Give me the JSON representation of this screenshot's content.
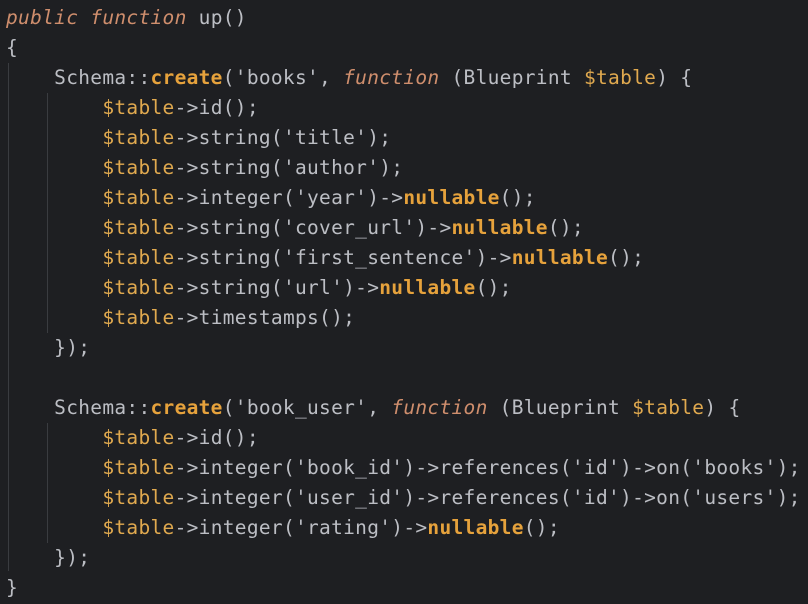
{
  "colors": {
    "background": "#1e1f22",
    "default_text": "#bcbec4",
    "keyword": "#cf8e6d",
    "function_call": "#e6a23c",
    "variable": "#e0a94f",
    "string": "#cfcfcf",
    "indent_guide": "#3a3c40"
  },
  "code": {
    "lines": [
      [
        {
          "t": "public",
          "c": "kw"
        },
        {
          "t": " ",
          "c": "tx"
        },
        {
          "t": "function",
          "c": "kw"
        },
        {
          "t": " up()",
          "c": "tx"
        }
      ],
      [
        {
          "t": "{",
          "c": "tx"
        }
      ],
      [
        {
          "t": "    Schema::",
          "c": "tx"
        },
        {
          "t": "create",
          "c": "fn"
        },
        {
          "t": "('books', ",
          "c": "tx"
        },
        {
          "t": "function",
          "c": "kw"
        },
        {
          "t": " (Blueprint ",
          "c": "tx"
        },
        {
          "t": "$table",
          "c": "var"
        },
        {
          "t": ") {",
          "c": "tx"
        }
      ],
      [
        {
          "t": "        ",
          "c": "tx"
        },
        {
          "t": "$table",
          "c": "var"
        },
        {
          "t": "->id();",
          "c": "tx"
        }
      ],
      [
        {
          "t": "        ",
          "c": "tx"
        },
        {
          "t": "$table",
          "c": "var"
        },
        {
          "t": "->string('title');",
          "c": "tx"
        }
      ],
      [
        {
          "t": "        ",
          "c": "tx"
        },
        {
          "t": "$table",
          "c": "var"
        },
        {
          "t": "->string('author');",
          "c": "tx"
        }
      ],
      [
        {
          "t": "        ",
          "c": "tx"
        },
        {
          "t": "$table",
          "c": "var"
        },
        {
          "t": "->integer('year')->",
          "c": "tx"
        },
        {
          "t": "nullable",
          "c": "fn"
        },
        {
          "t": "();",
          "c": "tx"
        }
      ],
      [
        {
          "t": "        ",
          "c": "tx"
        },
        {
          "t": "$table",
          "c": "var"
        },
        {
          "t": "->string('cover_url')->",
          "c": "tx"
        },
        {
          "t": "nullable",
          "c": "fn"
        },
        {
          "t": "();",
          "c": "tx"
        }
      ],
      [
        {
          "t": "        ",
          "c": "tx"
        },
        {
          "t": "$table",
          "c": "var"
        },
        {
          "t": "->string('first_sentence')->",
          "c": "tx"
        },
        {
          "t": "nullable",
          "c": "fn"
        },
        {
          "t": "();",
          "c": "tx"
        }
      ],
      [
        {
          "t": "        ",
          "c": "tx"
        },
        {
          "t": "$table",
          "c": "var"
        },
        {
          "t": "->string('url')->",
          "c": "tx"
        },
        {
          "t": "nullable",
          "c": "fn"
        },
        {
          "t": "();",
          "c": "tx"
        }
      ],
      [
        {
          "t": "        ",
          "c": "tx"
        },
        {
          "t": "$table",
          "c": "var"
        },
        {
          "t": "->timestamps();",
          "c": "tx"
        }
      ],
      [
        {
          "t": "    });",
          "c": "tx"
        }
      ],
      [
        {
          "t": "",
          "c": "tx"
        }
      ],
      [
        {
          "t": "    Schema::",
          "c": "tx"
        },
        {
          "t": "create",
          "c": "fn"
        },
        {
          "t": "('book_user', ",
          "c": "tx"
        },
        {
          "t": "function",
          "c": "kw"
        },
        {
          "t": " (Blueprint ",
          "c": "tx"
        },
        {
          "t": "$table",
          "c": "var"
        },
        {
          "t": ") {",
          "c": "tx"
        }
      ],
      [
        {
          "t": "        ",
          "c": "tx"
        },
        {
          "t": "$table",
          "c": "var"
        },
        {
          "t": "->id();",
          "c": "tx"
        }
      ],
      [
        {
          "t": "        ",
          "c": "tx"
        },
        {
          "t": "$table",
          "c": "var"
        },
        {
          "t": "->integer('book_id')->references('id')->on('books');",
          "c": "tx"
        }
      ],
      [
        {
          "t": "        ",
          "c": "tx"
        },
        {
          "t": "$table",
          "c": "var"
        },
        {
          "t": "->integer('user_id')->references('id')->on('users');",
          "c": "tx"
        }
      ],
      [
        {
          "t": "        ",
          "c": "tx"
        },
        {
          "t": "$table",
          "c": "var"
        },
        {
          "t": "->integer('rating')->",
          "c": "tx"
        },
        {
          "t": "nullable",
          "c": "fn"
        },
        {
          "t": "();",
          "c": "tx"
        }
      ],
      [
        {
          "t": "    });",
          "c": "tx"
        }
      ],
      [
        {
          "t": "}",
          "c": "tx"
        }
      ]
    ]
  }
}
